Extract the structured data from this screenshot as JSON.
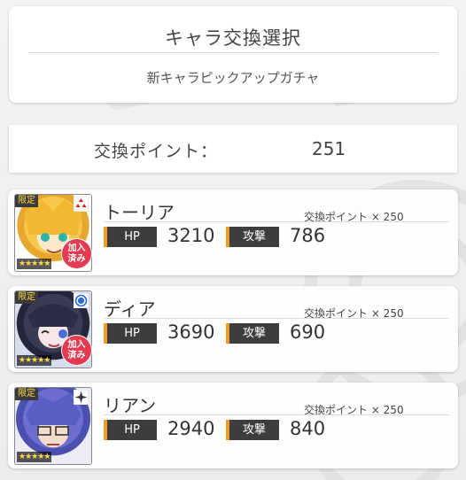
{
  "header": {
    "title": "キャラ交換選択",
    "subtitle": "新キャラピックアップガチャ"
  },
  "points": {
    "label": "交換ポイント：",
    "value": "251"
  },
  "characters": [
    {
      "name": "トーリア",
      "cost": "交換ポイント × 250",
      "hp_label": "HP",
      "hp": "3210",
      "atk_label": "攻撃",
      "atk": "786",
      "limited_tag": "限定",
      "stars": "★★★★★",
      "joined_badge": "加入\n済み",
      "corner_icon": "red-diamond-icon",
      "joined": true
    },
    {
      "name": "ディア",
      "cost": "交換ポイント × 250",
      "hp_label": "HP",
      "hp": "3690",
      "atk_label": "攻撃",
      "atk": "690",
      "limited_tag": "限定",
      "stars": "★★★★★",
      "joined_badge": "加入\n済み",
      "corner_icon": "blue-circle-icon",
      "joined": true
    },
    {
      "name": "リアン",
      "cost": "交換ポイント × 250",
      "hp_label": "HP",
      "hp": "2940",
      "atk_label": "攻撃",
      "atk": "840",
      "limited_tag": "限定",
      "stars": "★★★★★",
      "corner_icon": "dark-star-icon",
      "joined": false
    }
  ],
  "colors": {
    "accent": "#f09a2a",
    "label_bg": "#3d3d3d",
    "badge": "#e23b52"
  }
}
